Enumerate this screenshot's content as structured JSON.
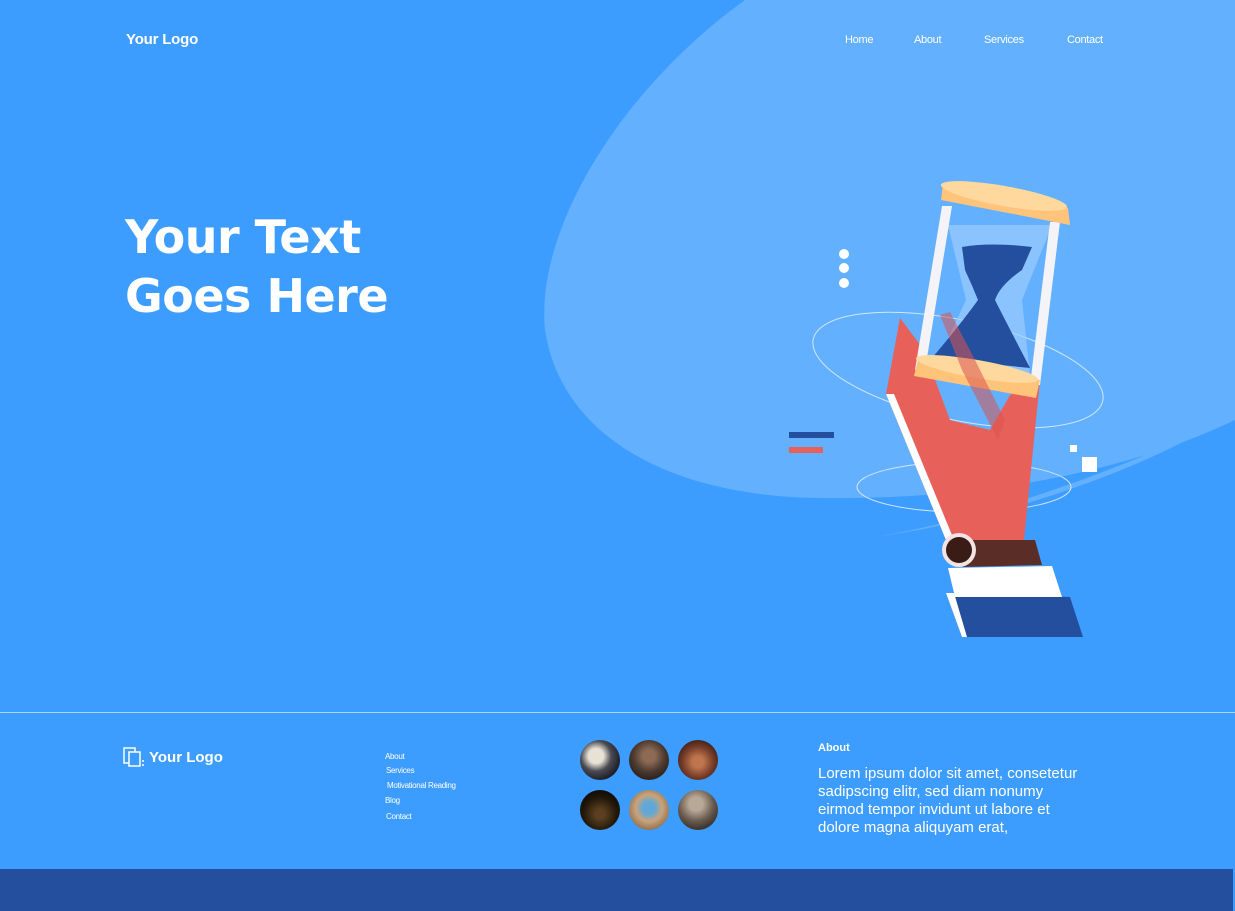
{
  "header": {
    "logo": "Your Logo",
    "nav": [
      {
        "label": "Home"
      },
      {
        "label": "About"
      },
      {
        "label": "Services"
      },
      {
        "label": "Contact"
      }
    ]
  },
  "hero": {
    "line1": "Your Text",
    "line2": "Goes Here"
  },
  "illustration": {
    "icon": "hand-holding-hourglass-icon"
  },
  "footer": {
    "logo": "Your Logo",
    "links": [
      {
        "label": "About"
      },
      {
        "label": "Services"
      },
      {
        "label": "Motivational Reading"
      },
      {
        "label": "Blog"
      },
      {
        "label": "Contact"
      }
    ],
    "about_title": "About",
    "about_text": "Lorem ipsum dolor sit amet, consetetur sadipscing elitr, sed diam nonumy eirmod tempor invidunt ut labore et dolore magna aliquyam erat,"
  },
  "colors": {
    "background": "#3d9dff",
    "light_shape": "#63b0ff",
    "accent_dark": "#244f9f",
    "accent_red": "#e8605a",
    "sand": "#ffc37a"
  }
}
